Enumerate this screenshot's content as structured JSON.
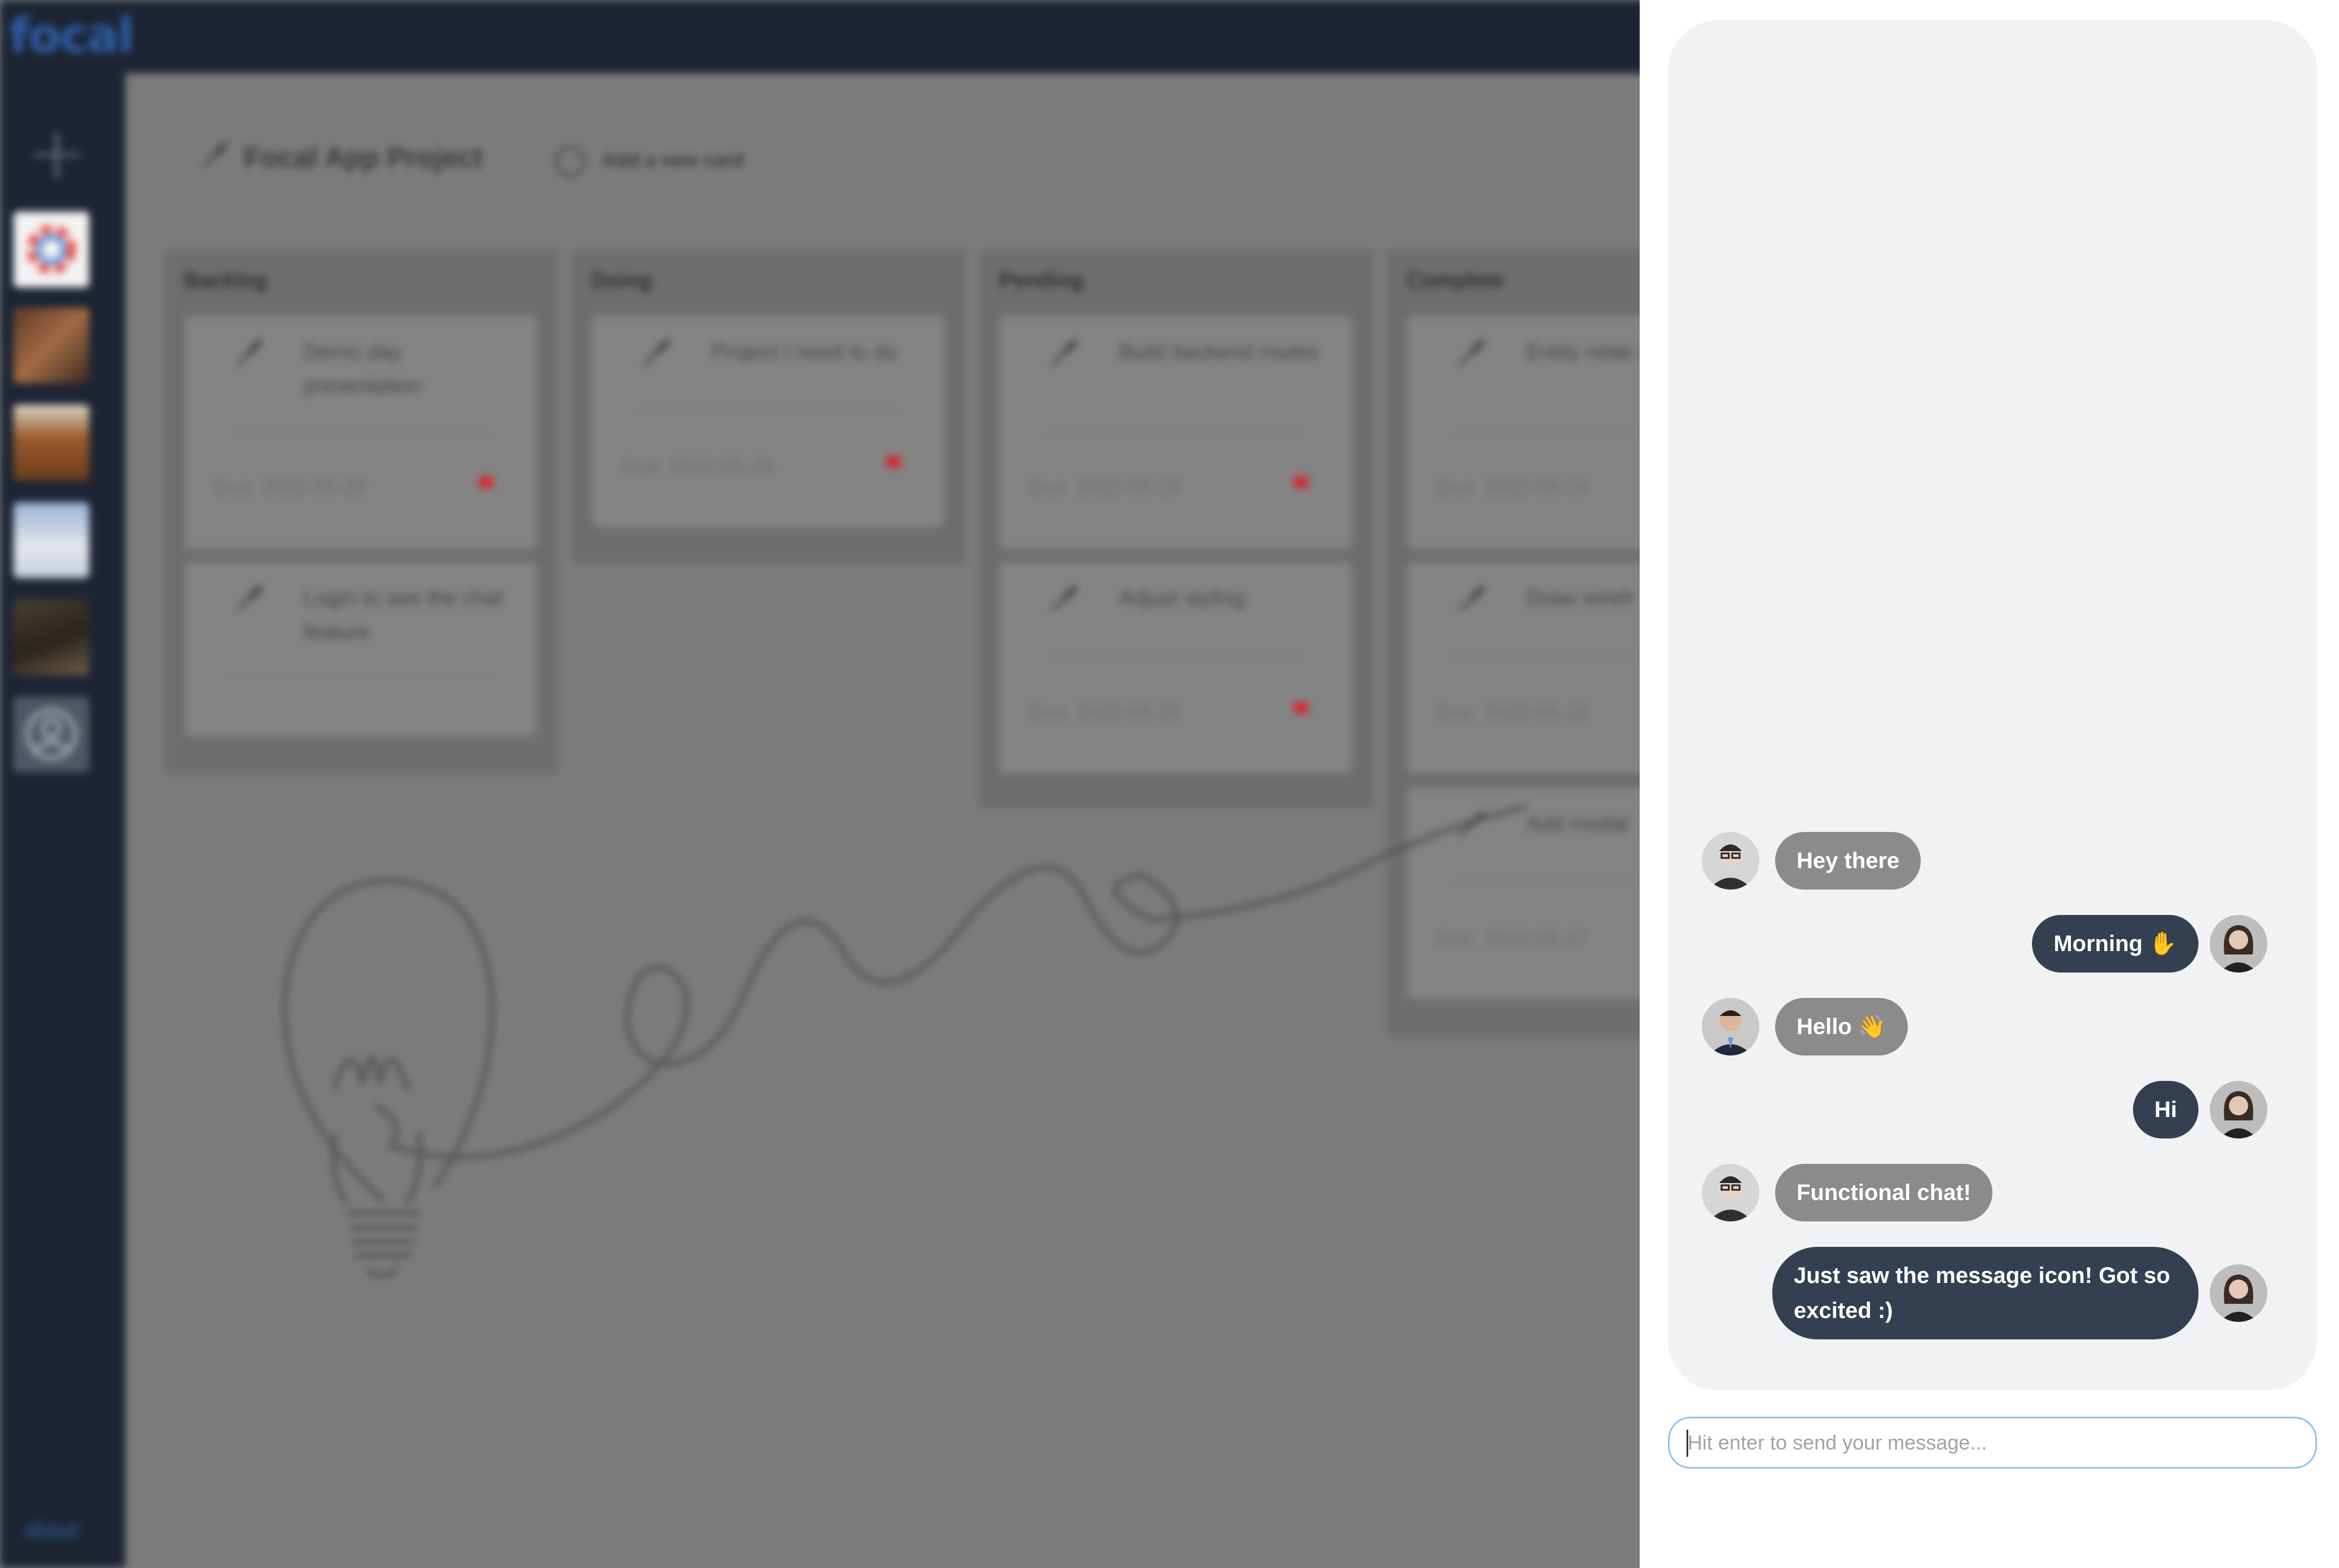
{
  "app": {
    "logo": "focal",
    "about_link": "about"
  },
  "project": {
    "title": "Focal App Project",
    "add_card_label": "Add a new card"
  },
  "columns": [
    {
      "title": "Backlog",
      "cards": [
        {
          "title": "Demo day presentation",
          "due": "Due: 2022-05-28",
          "flag": true
        },
        {
          "title": "Login to see the chat feature",
          "due": "",
          "flag": false
        }
      ]
    },
    {
      "title": "Doing",
      "cards": [
        {
          "title": "Project I need to do",
          "due": "Due: 2022-05-29",
          "flag": true
        }
      ]
    },
    {
      "title": "Pending",
      "cards": [
        {
          "title": "Build backend routes",
          "due": "Due: 2022-05-19",
          "flag": true
        },
        {
          "title": "Adjust styling",
          "due": "Due: 2022-05-25",
          "flag": true
        }
      ]
    },
    {
      "title": "Complete",
      "cards": [
        {
          "title": "Entity relati diagram",
          "due": "Due: 2022-05-14",
          "flag": false
        },
        {
          "title": "Draw wirefr",
          "due": "Due: 2022-05-15",
          "flag": false
        },
        {
          "title": "Add modal",
          "due": "Due: 2022-05-17",
          "flag": false
        }
      ]
    }
  ],
  "chat": {
    "messages": [
      {
        "direction": "in",
        "text": "Hey there",
        "avatar": "avatar-man-glasses-icon"
      },
      {
        "direction": "out",
        "text": "Morning ✋",
        "avatar": "avatar-woman-icon"
      },
      {
        "direction": "in",
        "text": "Hello 👋",
        "avatar": "avatar-man-suit-icon"
      },
      {
        "direction": "out",
        "text": "Hi",
        "avatar": "avatar-woman-icon"
      },
      {
        "direction": "in",
        "text": "Functional chat!",
        "avatar": "avatar-man-glasses-icon"
      },
      {
        "direction": "out",
        "text": "Just saw the message icon! Got so excited :)",
        "avatar": "avatar-woman-icon"
      }
    ],
    "input": {
      "value": "",
      "placeholder": "Hit enter to send your message..."
    }
  },
  "colors": {
    "incoming_bubble": "#8b8b8b",
    "outgoing_bubble": "#343f51",
    "nav_bg": "#1d2534",
    "flag_red": "#d8262e",
    "input_border": "#8fc3ea"
  }
}
